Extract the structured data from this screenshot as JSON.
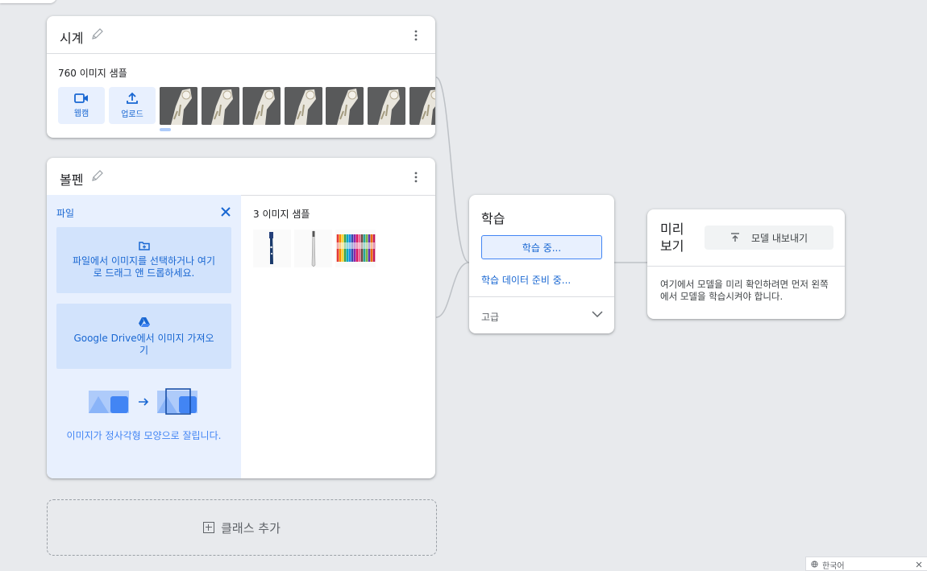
{
  "classes": [
    {
      "name": "시계",
      "samples_label": "760 이미지 샘플",
      "webcam_label": "웹캠",
      "upload_label": "업로드"
    },
    {
      "name": "볼펜",
      "samples_label": "3 이미지 샘플",
      "upload_panel": {
        "title": "파일",
        "drop_text": "파일에서 이미지를 선택하거나 여기로 드래그 앤 드롭하세요.",
        "drive_text_bold": "Google Drive",
        "drive_text": "에서 이미지 가져오기",
        "crop_note": "이미지가 정사각형 모양으로 잘립니다."
      }
    }
  ],
  "add_class_label": "클래스 추가",
  "training": {
    "title": "학습",
    "button_label": "학습 중...",
    "status": "학습 데이터 준비 중...",
    "advanced_label": "고급"
  },
  "preview": {
    "title": "미리 보기",
    "export_label": "모델 내보내기",
    "description": "여기에서 모델을 미리 확인하려면 먼저 왼쪽에서 모델을 학습시켜야 합니다."
  },
  "language": "한국어",
  "colors": {
    "accent": "#1967d2",
    "panel_bg": "#e8f0fe",
    "canvas_bg": "#e8eaed"
  },
  "icons": [
    "pencil-icon",
    "kebab-icon",
    "video-icon",
    "upload-icon",
    "close-icon",
    "folder-add-icon",
    "google-drive-icon",
    "chevron-down-icon",
    "export-icon",
    "globe-icon"
  ]
}
